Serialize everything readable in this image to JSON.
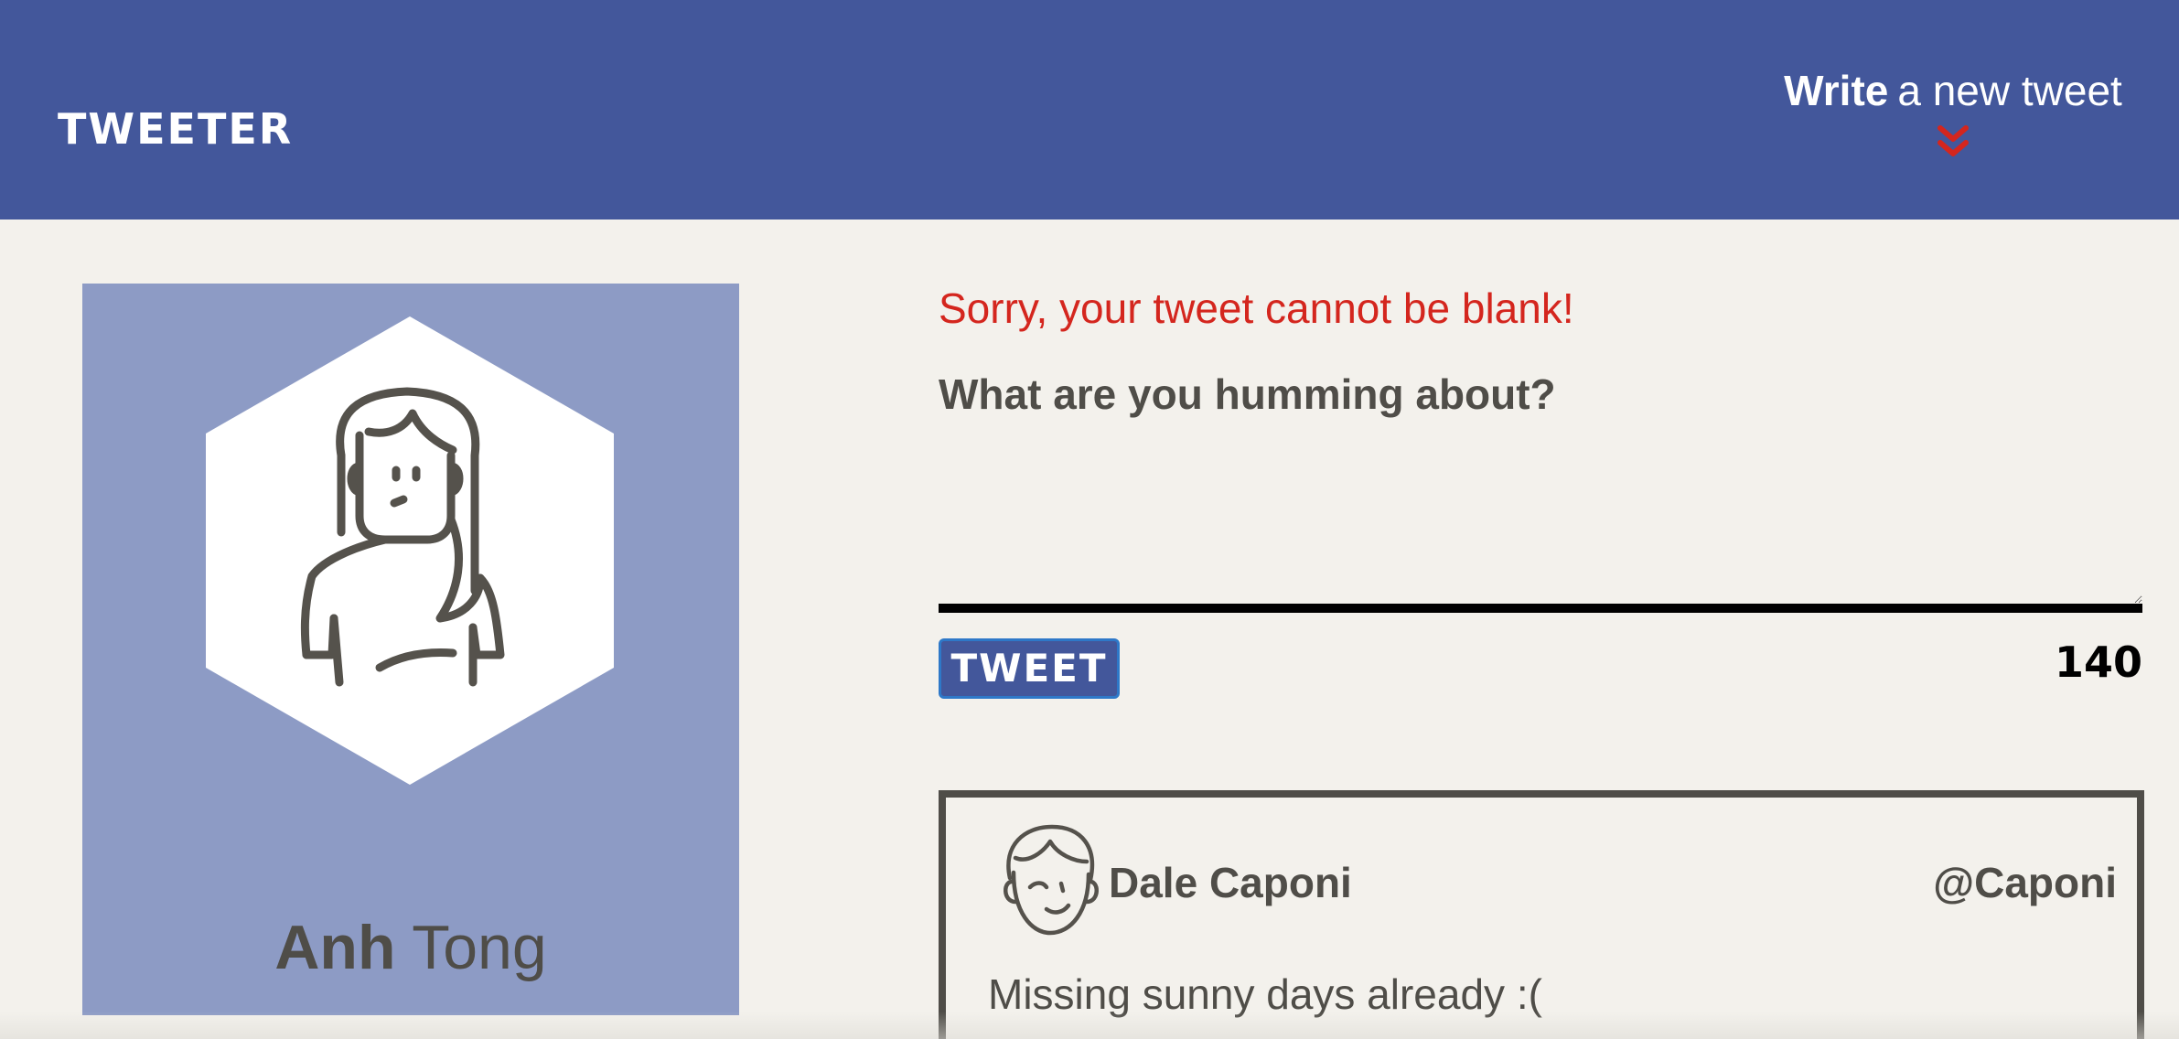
{
  "nav": {
    "brand": "TWEETER",
    "compose_toggle": {
      "strong": "Write",
      "rest": "a new tweet",
      "icon": "double-chevron-down-icon",
      "icon_color": "#d4261e"
    },
    "background_color": "#43579b"
  },
  "profile": {
    "avatar_icon": "woman-avatar-icon",
    "first_name": "Anh",
    "last_name": "Tong",
    "card_color": "#8d9bc5"
  },
  "compose": {
    "error": "Sorry, your tweet cannot be blank!",
    "prompt": "What are you humming about?",
    "input_value": "",
    "submit_label": "TWEET",
    "counter": "140"
  },
  "tweets": [
    {
      "avatar_icon": "winking-man-avatar-icon",
      "name": "Dale Caponi",
      "handle": "@Caponi",
      "content": "Missing sunny days already :("
    }
  ]
}
